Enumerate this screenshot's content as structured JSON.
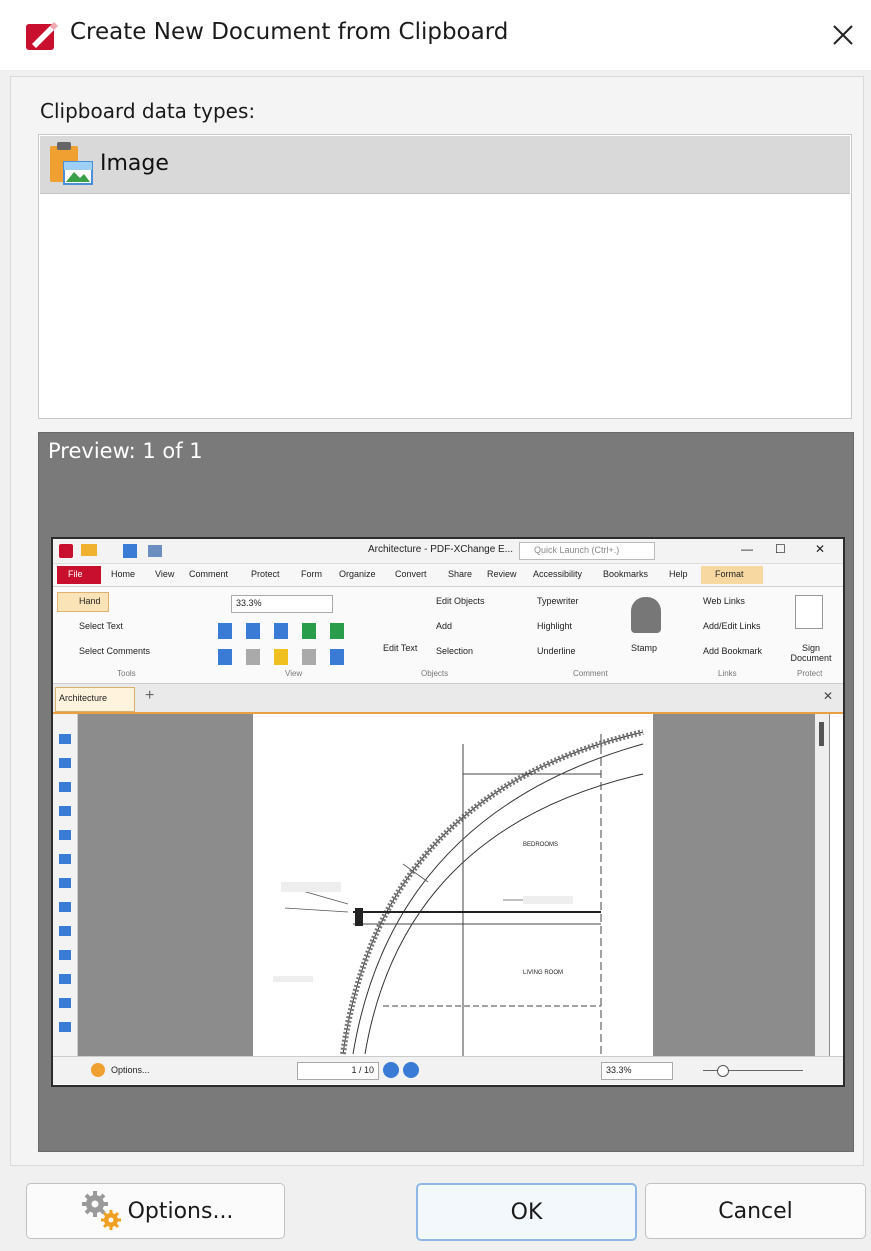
{
  "window": {
    "title": "Create New Document from Clipboard",
    "close_icon": "close-icon"
  },
  "clipboard": {
    "label": "Clipboard data types:",
    "items": [
      {
        "label": "Image",
        "icon": "clipboard-image-icon"
      }
    ]
  },
  "preview": {
    "label": "Preview: 1 of 1",
    "screenshot": {
      "app_title": "Architecture - PDF-XChange E...",
      "quick_launch_placeholder": "Quick Launch (Ctrl+.)",
      "ribbon_tabs": [
        "File",
        "Home",
        "View",
        "Comment",
        "Protect",
        "Form",
        "Organize",
        "Convert",
        "Share",
        "Review",
        "Accessibility",
        "Bookmarks",
        "Help",
        "Format"
      ],
      "tools": [
        "Hand",
        "Select Text",
        "Select Comments"
      ],
      "zoom": "33.3%",
      "objects": [
        "Edit Objects",
        "Add",
        "Selection",
        "Edit Text"
      ],
      "comment": [
        "Typewriter",
        "Highlight",
        "Underline",
        "Stamp"
      ],
      "links": [
        "Web Links",
        "Add/Edit Links",
        "Add Bookmark"
      ],
      "protect": "Sign Document",
      "groups": [
        "Tools",
        "View",
        "Objects",
        "Comment",
        "Links",
        "Protect"
      ],
      "doc_tab": "Architecture",
      "drawing_labels": [
        "BEDROOMS",
        "LIVING ROOM"
      ],
      "status_options": "Options...",
      "page_indicator": "1 / 10",
      "status_zoom": "33.3%"
    }
  },
  "buttons": {
    "options": "Options...",
    "ok": "OK",
    "cancel": "Cancel"
  },
  "colors": {
    "preview_background": "#7a7a7a",
    "ok_border": "#8fb8e6",
    "app_red": "#c8102e"
  }
}
